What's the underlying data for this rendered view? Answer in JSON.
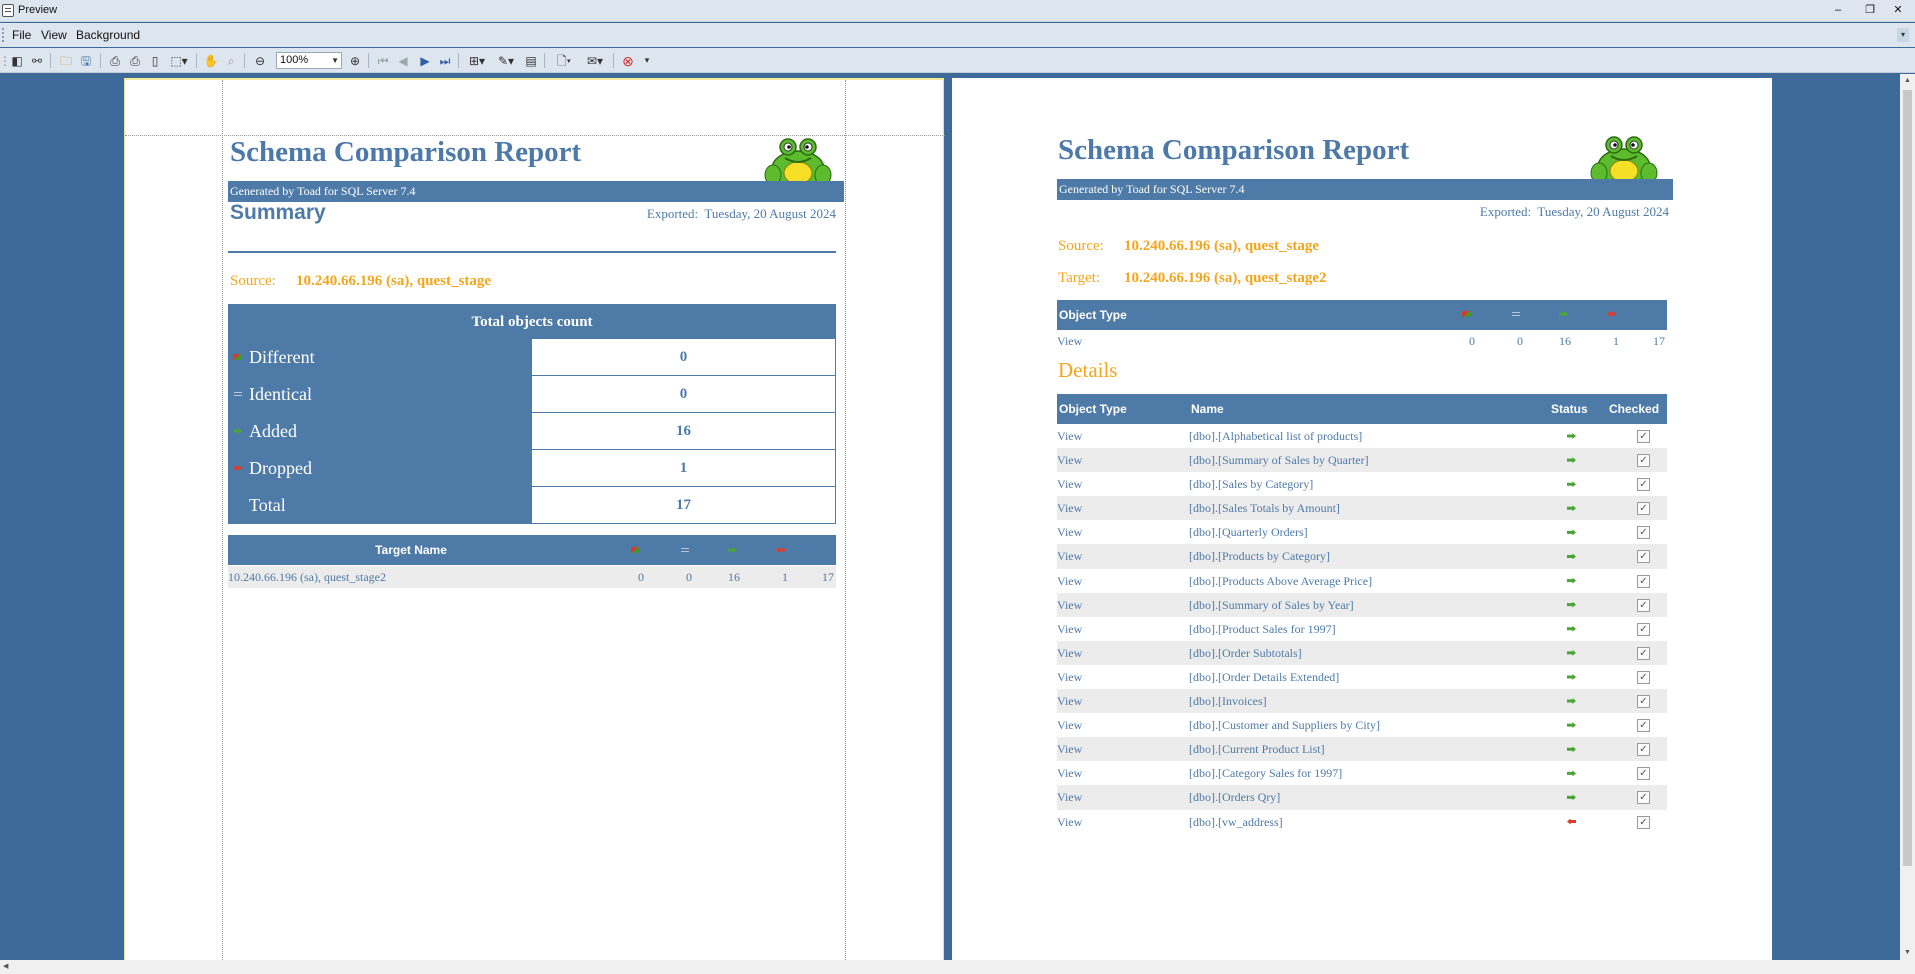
{
  "window": {
    "title": "Preview",
    "minimize": "–",
    "restore": "❐",
    "close": "✕"
  },
  "menu": {
    "file": "File",
    "view": "View",
    "background": "Background"
  },
  "toolbar": {
    "zoom_value": "100%"
  },
  "report": {
    "title": "Schema Comparison Report",
    "generated_by": "Generated by Toad for SQL Server 7.4",
    "exported_label": "Exported:",
    "exported_date": "Tuesday, 20 August 2024",
    "source_label": "Source:",
    "source_value": "10.240.66.196 (sa), quest_stage",
    "target_label": "Target:",
    "target_value": "10.240.66.196 (sa), quest_stage2"
  },
  "summary_page": {
    "heading": "Summary",
    "totals_title": "Total objects count",
    "rows": [
      {
        "icon": "different-icon",
        "label": "Different",
        "value": "0"
      },
      {
        "icon": "identical-icon",
        "label": "Identical",
        "value": "0"
      },
      {
        "icon": "added-icon",
        "label": "Added",
        "value": "16"
      },
      {
        "icon": "dropped-icon",
        "label": "Dropped",
        "value": "1"
      },
      {
        "icon": "",
        "label": "Total",
        "value": "17"
      }
    ],
    "target_table": {
      "header": "Target Name",
      "row": {
        "name": "10.240.66.196 (sa), quest_stage2",
        "different": "0",
        "identical": "0",
        "added": "16",
        "dropped": "1",
        "total": "17"
      }
    }
  },
  "details_page": {
    "summary_header": "Object Type",
    "summary_row": {
      "type": "View",
      "different": "0",
      "identical": "0",
      "added": "16",
      "dropped": "1",
      "total": "17"
    },
    "details_title": "Details",
    "columns": {
      "type": "Object Type",
      "name": "Name",
      "status": "Status",
      "checked": "Checked"
    },
    "rows": [
      {
        "type": "View",
        "name": "[dbo].[Alphabetical list of products]",
        "status": "added"
      },
      {
        "type": "View",
        "name": "[dbo].[Summary of Sales by Quarter]",
        "status": "added"
      },
      {
        "type": "View",
        "name": "[dbo].[Sales by Category]",
        "status": "added"
      },
      {
        "type": "View",
        "name": "[dbo].[Sales Totals by Amount]",
        "status": "added"
      },
      {
        "type": "View",
        "name": "[dbo].[Quarterly Orders]",
        "status": "added"
      },
      {
        "type": "View",
        "name": "[dbo].[Products by Category]",
        "status": "added"
      },
      {
        "type": "View",
        "name": "[dbo].[Products Above Average Price]",
        "status": "added"
      },
      {
        "type": "View",
        "name": "[dbo].[Summary of Sales by Year]",
        "status": "added"
      },
      {
        "type": "View",
        "name": "[dbo].[Product Sales for 1997]",
        "status": "added"
      },
      {
        "type": "View",
        "name": "[dbo].[Order Subtotals]",
        "status": "added"
      },
      {
        "type": "View",
        "name": "[dbo].[Order Details Extended]",
        "status": "added"
      },
      {
        "type": "View",
        "name": "[dbo].[Invoices]",
        "status": "added"
      },
      {
        "type": "View",
        "name": "[dbo].[Customer and Suppliers by City]",
        "status": "added"
      },
      {
        "type": "View",
        "name": "[dbo].[Current Product List]",
        "status": "added"
      },
      {
        "type": "View",
        "name": "[dbo].[Category Sales for 1997]",
        "status": "added"
      },
      {
        "type": "View",
        "name": "[dbo].[Orders Qry]",
        "status": "added"
      },
      {
        "type": "View",
        "name": "[dbo].[vw_address]",
        "status": "dropped"
      }
    ]
  },
  "colors": {
    "accent": "#4e7aa8",
    "highlight": "#f3a51b",
    "background": "#3e6a99"
  }
}
